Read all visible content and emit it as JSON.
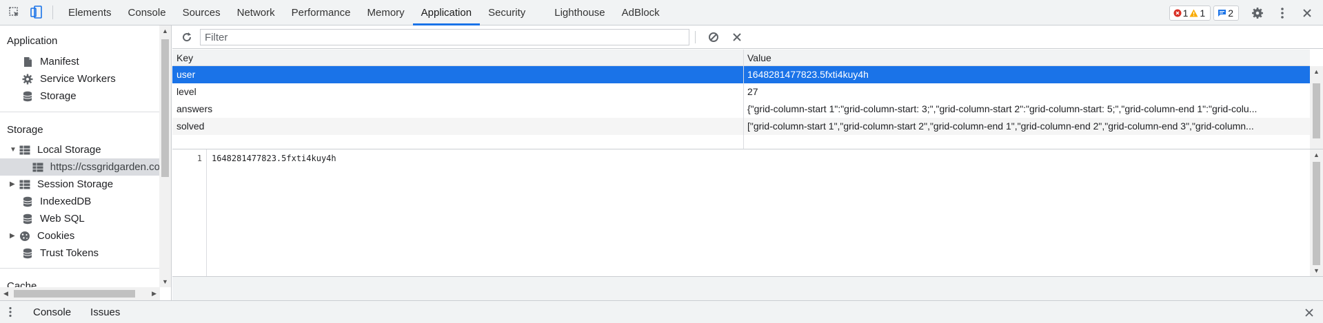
{
  "tabs": [
    "Elements",
    "Console",
    "Sources",
    "Network",
    "Performance",
    "Memory",
    "Application",
    "Security",
    "Lighthouse",
    "AdBlock"
  ],
  "active_tab": "Application",
  "status": {
    "errors": "1",
    "warnings": "1",
    "messages": "2"
  },
  "sidebar": {
    "application_title": "Application",
    "application_items": [
      "Manifest",
      "Service Workers",
      "Storage"
    ],
    "storage_title": "Storage",
    "local_storage": "Local Storage",
    "local_storage_child": "https://cssgridgarden.co",
    "session_storage": "Session Storage",
    "indexeddb": "IndexedDB",
    "websql": "Web SQL",
    "cookies": "Cookies",
    "trust_tokens": "Trust Tokens",
    "cutoff_title": "Cache"
  },
  "toolbar": {
    "filter_placeholder": "Filter"
  },
  "table": {
    "headers": {
      "key": "Key",
      "value": "Value"
    },
    "rows": [
      {
        "key": "user",
        "value": "1648281477823.5fxti4kuy4h"
      },
      {
        "key": "level",
        "value": "27"
      },
      {
        "key": "answers",
        "value": "{\"grid-column-start 1\":\"grid-column-start: 3;\",\"grid-column-start 2\":\"grid-column-start: 5;\",\"grid-column-end 1\":\"grid-colu..."
      },
      {
        "key": "solved",
        "value": "[\"grid-column-start 1\",\"grid-column-start 2\",\"grid-column-end 1\",\"grid-column-end 2\",\"grid-column-end 3\",\"grid-column..."
      }
    ]
  },
  "preview": {
    "line_number": "1",
    "text": "1648281477823.5fxti4kuy4h"
  },
  "drawer": {
    "tabs": [
      "Console",
      "Issues"
    ]
  }
}
